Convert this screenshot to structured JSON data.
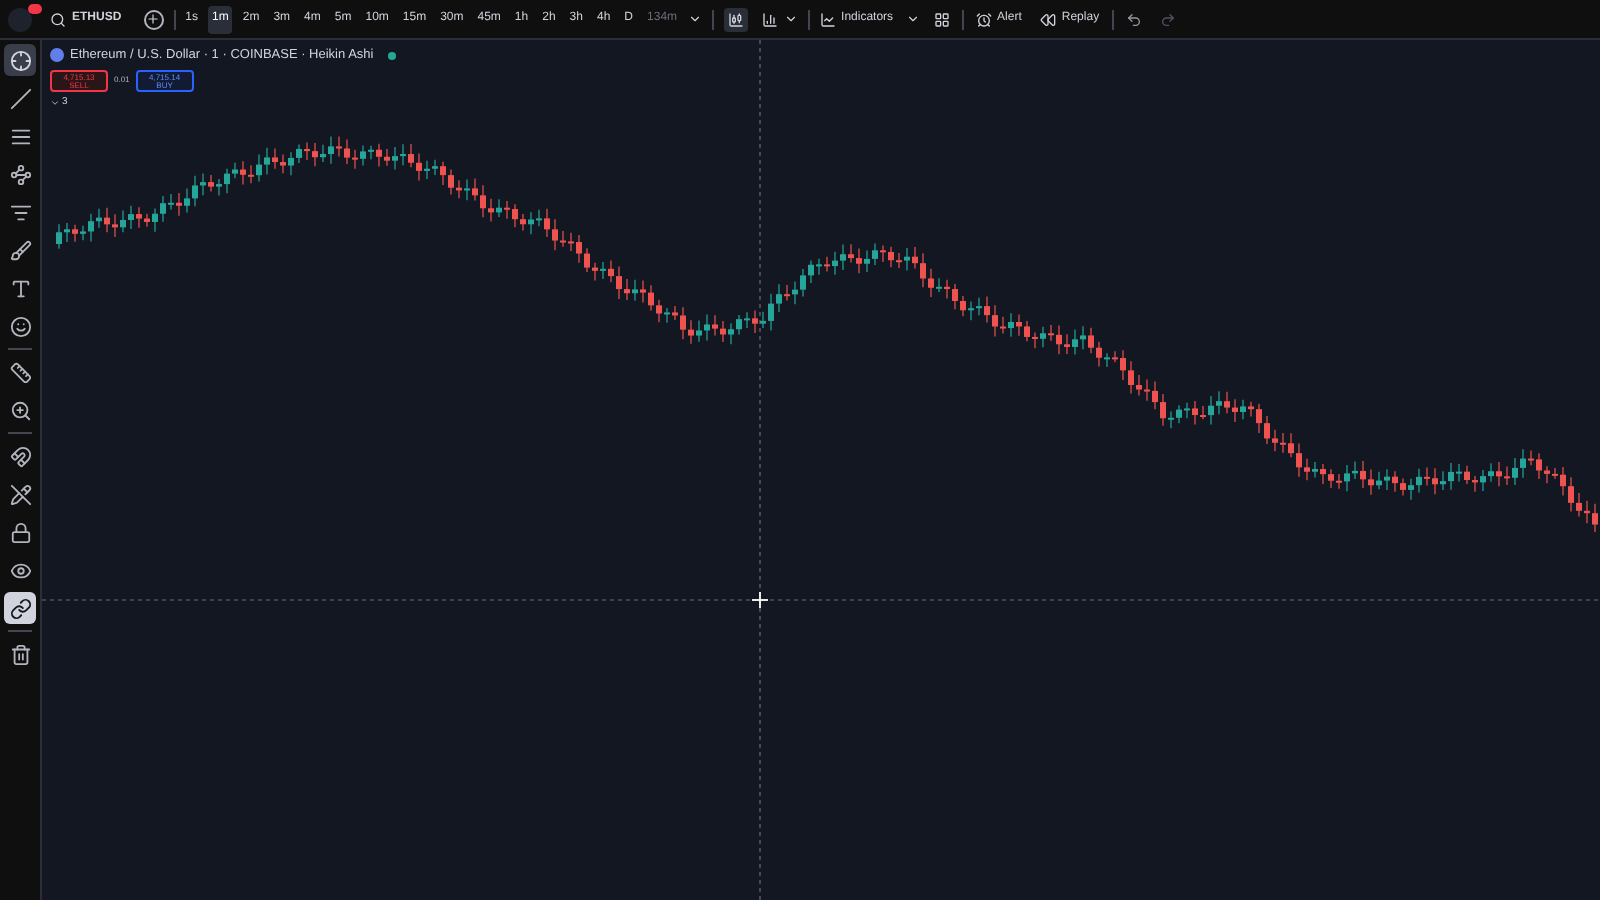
{
  "top_bar": {
    "symbol": "ETHUSD",
    "timeframes": [
      {
        "label": "1s",
        "selected": false
      },
      {
        "label": "1m",
        "selected": true
      },
      {
        "label": "2m",
        "selected": false
      },
      {
        "label": "3m",
        "selected": false
      },
      {
        "label": "4m",
        "selected": false
      },
      {
        "label": "5m",
        "selected": false
      },
      {
        "label": "10m",
        "selected": false
      },
      {
        "label": "15m",
        "selected": false
      },
      {
        "label": "30m",
        "selected": false
      },
      {
        "label": "45m",
        "selected": false
      },
      {
        "label": "1h",
        "selected": false
      },
      {
        "label": "2h",
        "selected": false
      },
      {
        "label": "3h",
        "selected": false
      },
      {
        "label": "4h",
        "selected": false
      },
      {
        "label": "D",
        "selected": false
      },
      {
        "label": "134m",
        "selected": false
      }
    ],
    "indicators": "Indicators",
    "alert": "Alert",
    "replay": "Replay"
  },
  "tools": [
    {
      "selected": true
    },
    {
      "selected": false
    },
    {
      "selected": false
    },
    {
      "selected": false
    },
    {
      "selected": false
    },
    {
      "selected": false
    },
    {
      "selected": false
    },
    {
      "selected": false
    }
  ],
  "measure_tools": [
    {
      "selected": false
    },
    {
      "selected": false
    }
  ],
  "toggles": [
    {
      "on": false
    },
    {
      "on": false
    },
    {
      "on": false
    },
    {
      "on": false
    },
    {
      "on": true
    }
  ],
  "legend": {
    "title": "Ethereum / U.S. Dollar · 1 · COINBASE · Heikin Ashi",
    "market_open": true,
    "sell_price": "4,715.13",
    "sell_label": "SELL",
    "spread": "0.01",
    "buy_price": "4,715.14",
    "buy_label": "BUY",
    "collapsed_count": "3"
  }
}
